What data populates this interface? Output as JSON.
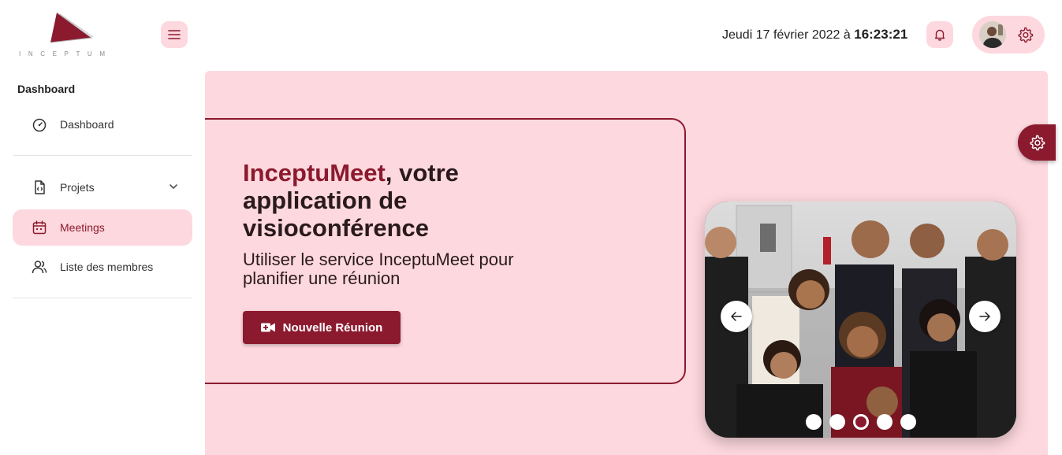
{
  "brand": {
    "logo_text": "INCEPTUM",
    "accent": "#8b1a2e",
    "soft": "#fdd8de"
  },
  "header": {
    "date_prefix": "Jeudi 17 février 2022 à",
    "time": "16:23:21"
  },
  "sidebar": {
    "section_title": "Dashboard",
    "items": [
      {
        "label": "Dashboard",
        "icon": "gauge-icon",
        "active": false
      },
      {
        "label": "Projets",
        "icon": "file-code-icon",
        "active": false,
        "expandable": true
      },
      {
        "label": "Meetings",
        "icon": "calendar-icon",
        "active": true
      },
      {
        "label": "Liste des membres",
        "icon": "users-icon",
        "active": false
      }
    ]
  },
  "hero": {
    "brand_word": "InceptuMeet",
    "title_rest": ", votre application de visioconférence",
    "subtitle": "Utiliser le service InceptuMeet pour planifier une réunion",
    "button_label": "Nouvelle Réunion"
  },
  "carousel": {
    "slides": 5,
    "active_index": 2
  }
}
